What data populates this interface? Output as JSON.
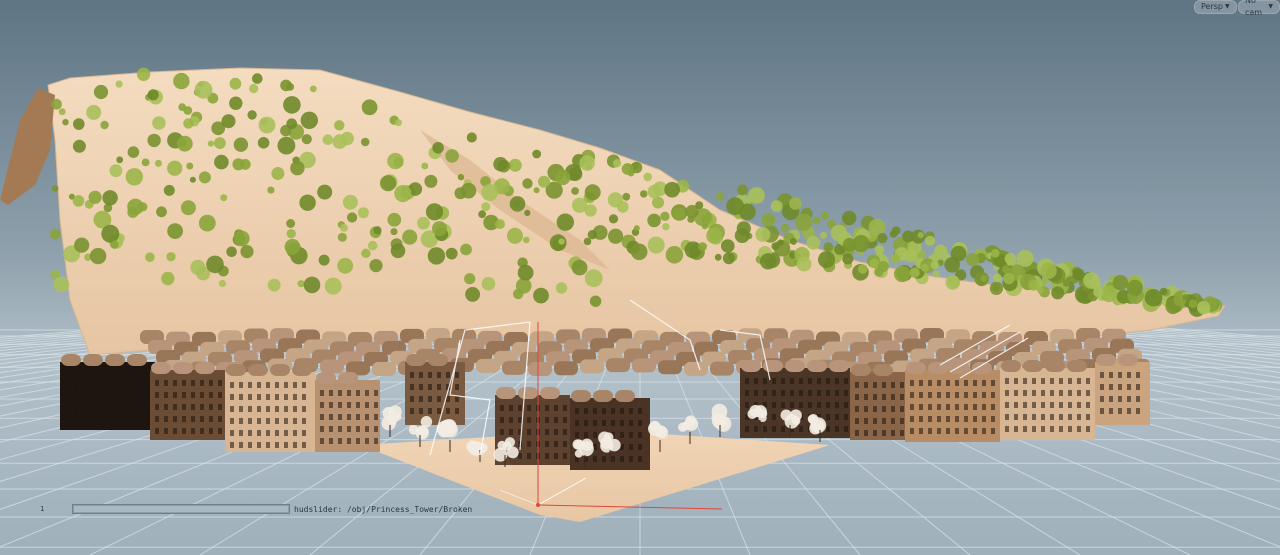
{
  "viewport": {
    "camera_mode": "Persp",
    "camera_name": "No cam"
  },
  "hud_slider": {
    "value": "1",
    "fraction": 1.0,
    "label": "hudslider: /obj/Princess_Tower/Broken"
  },
  "colors": {
    "sky_top": "#5f7584",
    "sky_horizon": "#b2c0c9",
    "grid_line": "#d8e2e8",
    "terrain": "#ecd2b4",
    "foliage": "#8aa43a",
    "building_light": "#d9b693",
    "building_dark": "#7a5a40",
    "axis_x": "#e2453c",
    "axis_z": "#ffffff"
  },
  "icons": {
    "dropdown": "chevron-down-icon",
    "axis": "axis-gizmo-icon"
  }
}
